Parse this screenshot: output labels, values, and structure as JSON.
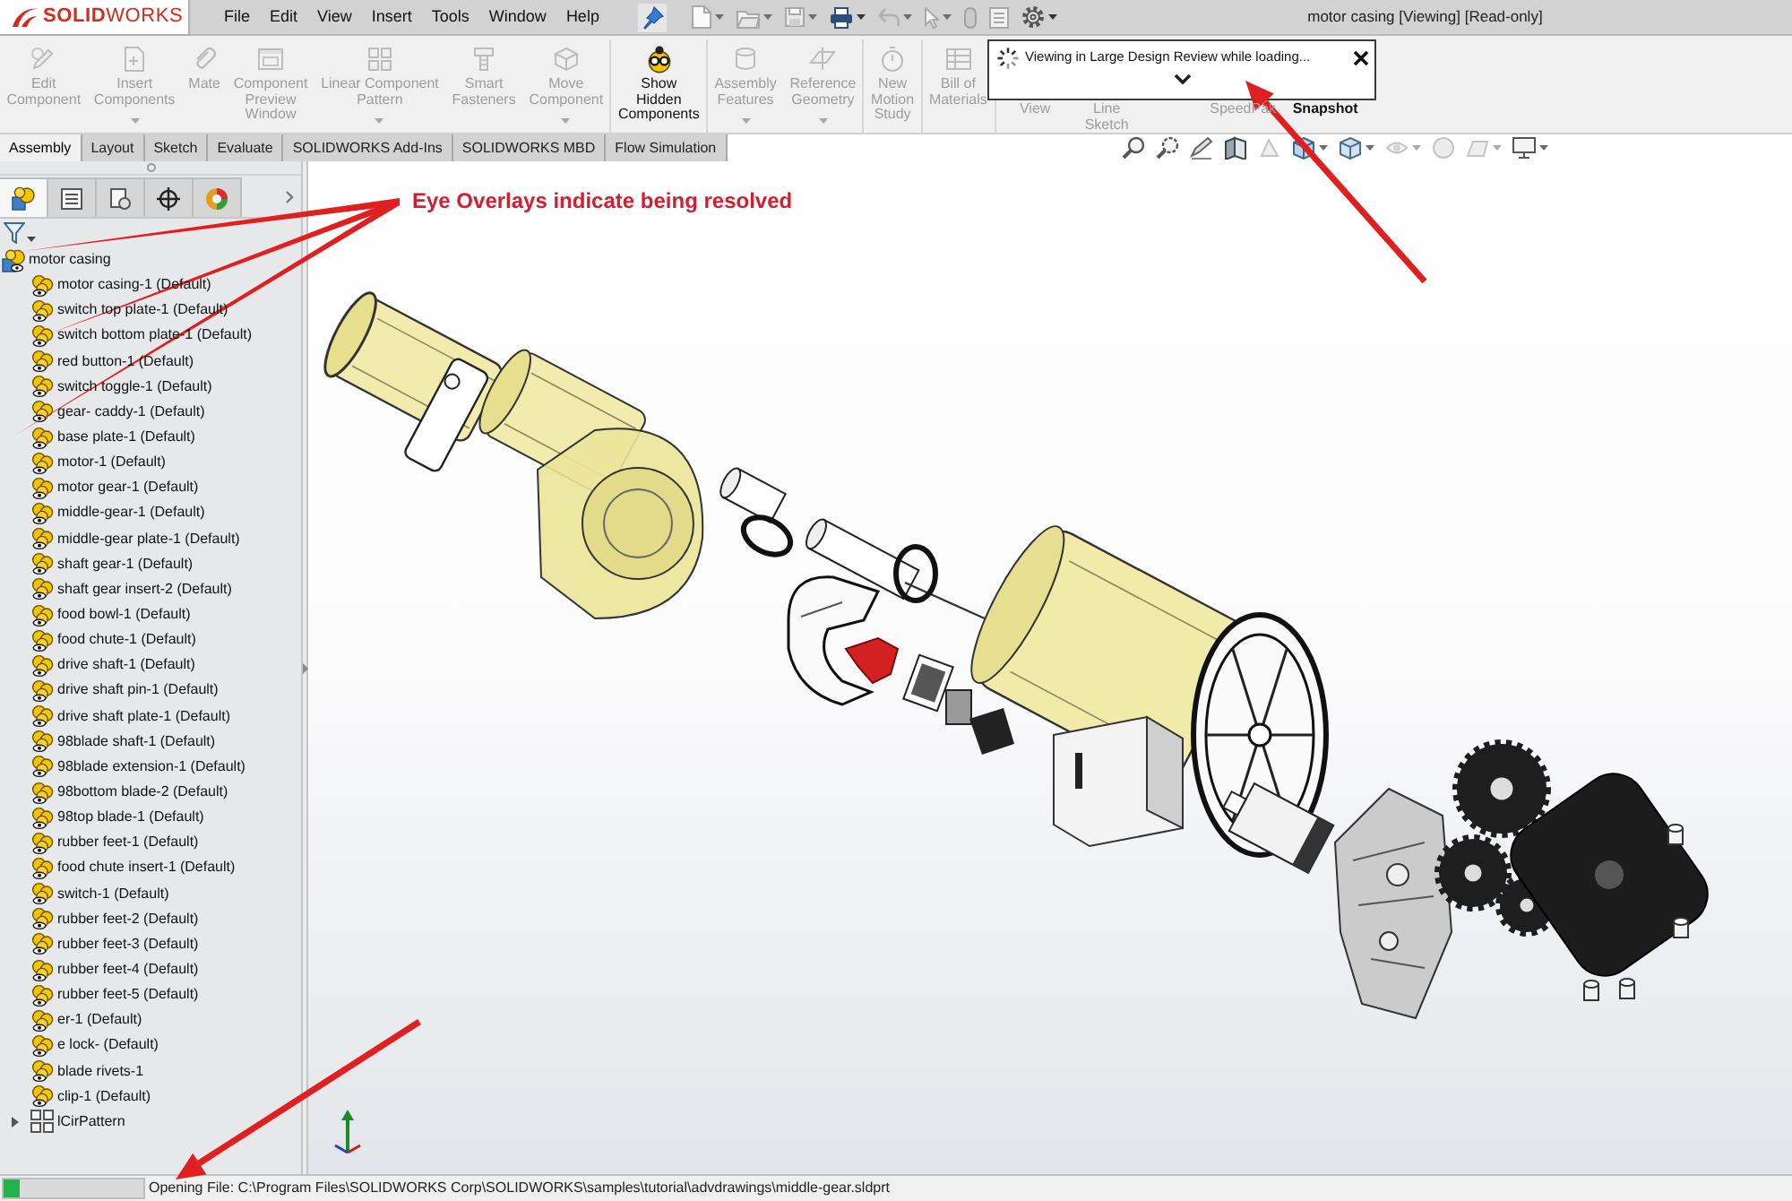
{
  "title_bar": {
    "logo": "**SOLID**WORKS",
    "menu": [
      "File",
      "Edit",
      "View",
      "Insert",
      "Tools",
      "Window",
      "Help"
    ],
    "document_title": "motor casing [Viewing] [Read-only]"
  },
  "ribbon": {
    "groups": [
      [
        {
          "label": "Edit\nComponent",
          "disabled": true,
          "has_menu": false
        },
        {
          "label": "Insert\nComponents",
          "disabled": true,
          "has_menu": true
        },
        {
          "label": "Mate",
          "disabled": true,
          "has_menu": false
        },
        {
          "label": "Component\nPreview\nWindow",
          "disabled": true,
          "has_menu": false
        },
        {
          "label": "Linear Component\nPattern",
          "disabled": true,
          "has_menu": true
        },
        {
          "label": "Smart\nFasteners",
          "disabled": true,
          "has_menu": false
        },
        {
          "label": "Move\nComponent",
          "disabled": true,
          "has_menu": true
        }
      ],
      [
        {
          "label": "Show\nHidden\nComponents",
          "disabled": false,
          "has_menu": false
        }
      ],
      [
        {
          "label": "Assembly\nFeatures",
          "disabled": true,
          "has_menu": true
        },
        {
          "label": "Reference\nGeometry",
          "disabled": true,
          "has_menu": true
        }
      ],
      [
        {
          "label": "New\nMotion\nStudy",
          "disabled": true,
          "has_menu": false
        }
      ],
      [
        {
          "label": "Bill of\nMaterials",
          "disabled": true,
          "has_menu": false
        }
      ]
    ],
    "covered_commands": [
      {
        "label": "View",
        "disabled": true
      },
      {
        "label": "Line\nSketch",
        "disabled": true
      },
      {
        "label": "SpeedPak",
        "disabled": true
      },
      {
        "label": "Snapshot",
        "disabled": false
      }
    ]
  },
  "loading_popup": {
    "message": "Viewing in Large Design Review while loading...",
    "expanded": false
  },
  "tabs": [
    {
      "label": "Assembly",
      "selected": true
    },
    {
      "label": "Layout",
      "selected": false
    },
    {
      "label": "Sketch",
      "selected": false
    },
    {
      "label": "Evaluate",
      "selected": false
    },
    {
      "label": "SOLIDWORKS Add-Ins",
      "selected": false
    },
    {
      "label": "SOLIDWORKS MBD",
      "selected": false
    },
    {
      "label": "Flow Simulation",
      "selected": false
    }
  ],
  "feature_manager": {
    "panel_tabs": [
      {
        "kind": "tree",
        "selected": true
      },
      {
        "kind": "properties",
        "selected": false
      },
      {
        "kind": "configurations",
        "selected": false
      },
      {
        "kind": "dimxpert",
        "selected": false
      },
      {
        "kind": "display",
        "selected": false
      }
    ],
    "tree": [
      {
        "label": "motor casing",
        "kind": "assembly",
        "children": [
          {
            "label": "motor casing-1 (Default)",
            "kind": "part"
          },
          {
            "label": "switch top plate-1 (Default)",
            "kind": "part"
          },
          {
            "label": "switch bottom plate-1 (Default)",
            "kind": "part"
          },
          {
            "label": "red button-1 (Default)",
            "kind": "part"
          },
          {
            "label": "switch toggle-1 (Default)",
            "kind": "part"
          },
          {
            "label": "gear- caddy-1 (Default)",
            "kind": "part"
          },
          {
            "label": "base plate-1 (Default)",
            "kind": "part"
          },
          {
            "label": "motor-1 (Default)",
            "kind": "part"
          },
          {
            "label": "motor gear-1 (Default)",
            "kind": "part"
          },
          {
            "label": "middle-gear-1 (Default)",
            "kind": "part"
          },
          {
            "label": "middle-gear plate-1 (Default)",
            "kind": "part"
          },
          {
            "label": "shaft gear-1 (Default)",
            "kind": "part"
          },
          {
            "label": "shaft gear insert-2 (Default)",
            "kind": "part"
          },
          {
            "label": "food bowl-1 (Default)",
            "kind": "part"
          },
          {
            "label": "food chute-1 (Default)",
            "kind": "part"
          },
          {
            "label": "drive shaft-1 (Default)",
            "kind": "part"
          },
          {
            "label": "drive shaft pin-1 (Default)",
            "kind": "part"
          },
          {
            "label": "drive shaft plate-1 (Default)",
            "kind": "part"
          },
          {
            "label": "98blade shaft-1 (Default)",
            "kind": "part"
          },
          {
            "label": "98blade extension-1 (Default)",
            "kind": "part"
          },
          {
            "label": "98bottom blade-2 (Default)",
            "kind": "part"
          },
          {
            "label": "98top blade-1 (Default)",
            "kind": "part"
          },
          {
            "label": "rubber feet-1 (Default)",
            "kind": "part"
          },
          {
            "label": "food chute insert-1 (Default)",
            "kind": "part"
          },
          {
            "label": "switch-1 (Default)",
            "kind": "part"
          },
          {
            "label": "rubber feet-2 (Default)",
            "kind": "part"
          },
          {
            "label": "rubber feet-3 (Default)",
            "kind": "part"
          },
          {
            "label": "rubber feet-4 (Default)",
            "kind": "part"
          },
          {
            "label": "rubber feet-5 (Default)",
            "kind": "part"
          },
          {
            "label": "er-1 (Default)",
            "kind": "part"
          },
          {
            "label": "e lock- (Default)",
            "kind": "part"
          },
          {
            "label": "blade rivets-1",
            "kind": "part"
          },
          {
            "label": "clip-1 (Default)",
            "kind": "part"
          },
          {
            "label": "lCirPattern",
            "kind": "pattern",
            "expanded": false
          }
        ]
      }
    ]
  },
  "annotation": {
    "text": "Eye Overlays indicate being resolved"
  },
  "status_bar": {
    "progress": {
      "level": 0.12
    },
    "message": "Opening File: C:\\Program Files\\SOLIDWORKS Corp\\SOLIDWORKS\\samples\\tutorial\\advdrawings\\middle-gear.sldprt"
  }
}
